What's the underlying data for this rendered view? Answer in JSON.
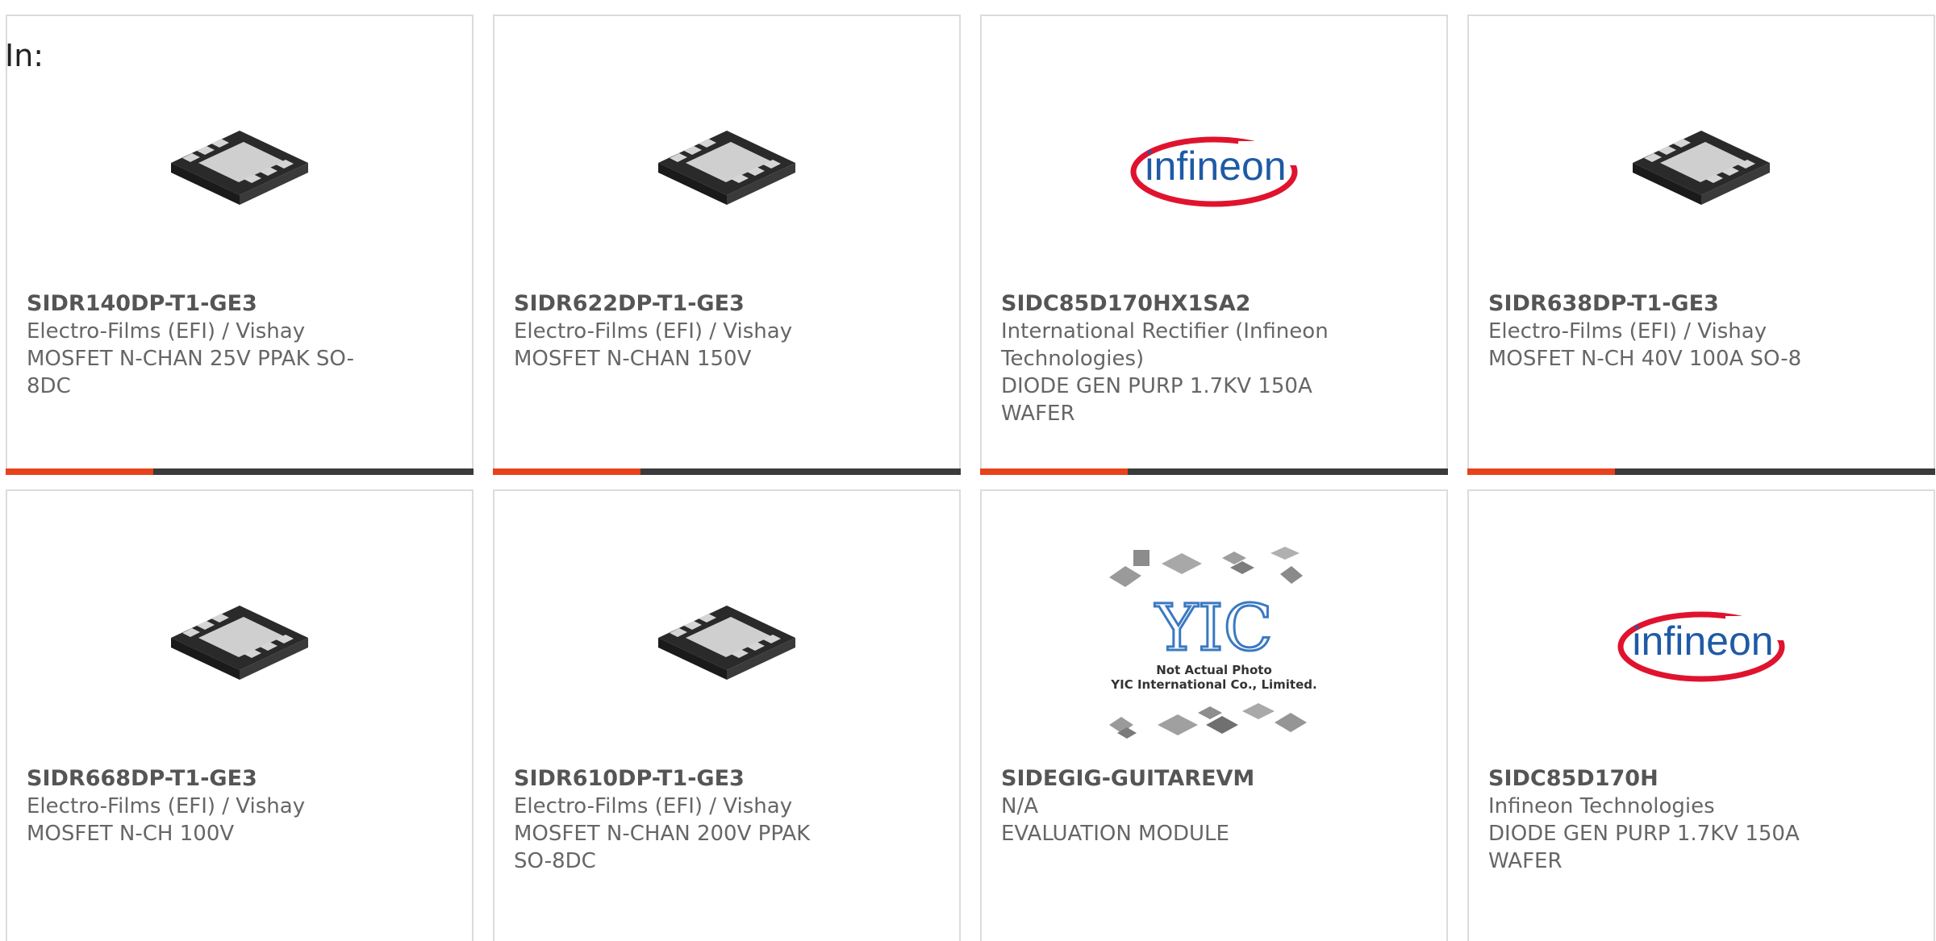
{
  "header": {
    "label": "In:"
  },
  "cards": [
    {
      "pn": "SIDR140DP-T1-GE3",
      "manufacturer": "Electro-Films (EFI) / Vishay",
      "description": "MOSFET N-CHAN 25V PPAK SO-8DC",
      "image": "chip-package-image"
    },
    {
      "pn": "SIDR622DP-T1-GE3",
      "manufacturer": "Electro-Films (EFI) / Vishay",
      "description": "MOSFET N-CHAN 150V",
      "image": "chip-package-image"
    },
    {
      "pn": "SIDC85D170HX1SA2",
      "manufacturer": "International Rectifier (Infineon Technologies)",
      "description": "DIODE GEN PURP 1.7KV 150A WAFER",
      "image": "infineon-logo",
      "logo_text": "infineon"
    },
    {
      "pn": "SIDR638DP-T1-GE3",
      "manufacturer": "Electro-Films (EFI) / Vishay",
      "description": "MOSFET N-CH 40V 100A SO-8",
      "image": "chip-package-image"
    },
    {
      "pn": "SIDR668DP-T1-GE3",
      "manufacturer": "Electro-Films (EFI) / Vishay",
      "description": "MOSFET N-CH 100V",
      "image": "chip-package-image"
    },
    {
      "pn": "SIDR610DP-T1-GE3",
      "manufacturer": "Electro-Films (EFI) / Vishay",
      "description": "MOSFET N-CHAN 200V PPAK SO-8DC",
      "image": "chip-package-image"
    },
    {
      "pn": "SIDEGIG-GUITAREVM",
      "manufacturer": "N/A",
      "description": "EVALUATION MODULE",
      "image": "placeholder-collage",
      "placeholder_text_1": "Not Actual Photo",
      "placeholder_text_2": "YIC International Co., Limited.",
      "placeholder_logo": "YIC"
    },
    {
      "pn": "SIDC85D170H",
      "manufacturer": "Infineon Technologies",
      "description": "DIODE GEN PURP 1.7KV 150A WAFER",
      "image": "infineon-logo",
      "logo_text": "infineon"
    }
  ],
  "colors": {
    "accent": "#e8421c",
    "bar": "#3b3b3b",
    "border": "#dcdcdc",
    "infineon_blue": "#1f5aa6",
    "infineon_red": "#e0132e"
  }
}
